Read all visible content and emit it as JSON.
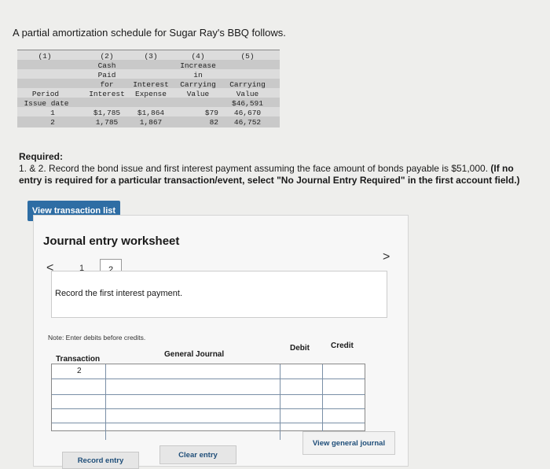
{
  "intro_text": "A partial amortization schedule for Sugar Ray's BBQ follows.",
  "schedule": {
    "col1": "(1)",
    "col2": "(2)\nCash\nPaid\nfor\nInterest",
    "col3": "(3)\n\n\nInterest\nExpense",
    "col4": "(4)\nIncrease\nin\nCarrying\nValue",
    "col5": "(5)\n\n\nCarrying\nValue",
    "period_label": "Period",
    "issue_date_label": "Issue date",
    "issue_carrying_value": "$46,591",
    "rows": [
      {
        "period": "1",
        "cash": "$1,785",
        "interest": "$1,864",
        "increase": "$79",
        "carrying": "46,670"
      },
      {
        "period": "2",
        "cash": "1,785",
        "interest": "1,867",
        "increase": "82",
        "carrying": "46,752"
      }
    ]
  },
  "required": {
    "heading": "Required:",
    "line_prefix": "1. & 2. Record the bond issue and first interest payment assuming the face amount of bonds payable is $51,000.",
    "line_bold": "(If no entry is required for a particular transaction/event, select \"No Journal Entry Required\" in the first account field.)"
  },
  "buttons": {
    "view_transaction_list": "View transaction list",
    "record_entry": "Record entry",
    "clear_entry": "Clear entry",
    "view_general_journal": "View general journal"
  },
  "worksheet": {
    "title": "Journal entry worksheet",
    "pager": {
      "prev_glyph": "<",
      "next_glyph": ">",
      "page1": "1",
      "page2": "2"
    },
    "instruction": "Record the first interest payment.",
    "note": "Note: Enter debits before credits.",
    "headers": {
      "transaction": "Transaction",
      "general_journal": "General Journal",
      "debit": "Debit",
      "credit": "Credit"
    },
    "transaction_number": "2"
  }
}
